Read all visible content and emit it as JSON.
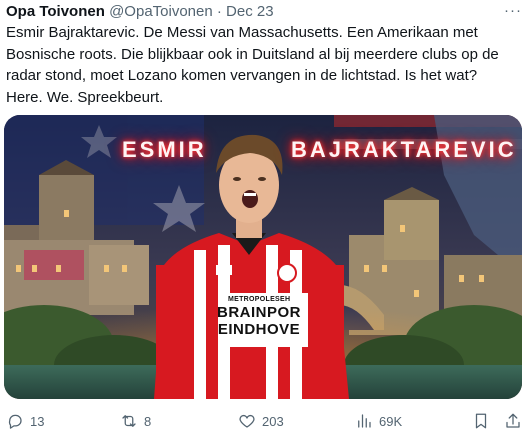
{
  "tweet": {
    "author_name": "Opa Toivonen",
    "author_handle": "@OpaToivonen",
    "separator": "·",
    "date": "Dec 23",
    "more": "···",
    "text": "Esmir Bajraktarevic. De Messi van Massachusetts. Een Amerikaan met\nBosnische roots. Die blijkbaar ook in Duitsland al bij meerdere clubs op de\nradar stond, moet Lozano komen vervangen in de lichtstad. Is het wat?\nHere. We. Spreekbeurt."
  },
  "media": {
    "first_name": "ESMIR",
    "last_name": "BAJRAKTAREVIC",
    "shirt_sponsor_top": "METROPOLESEH",
    "shirt_line1": "BRAINPOR",
    "shirt_line2": "EINDHOVE"
  },
  "actions": {
    "replies": "13",
    "reposts": "8",
    "likes": "203",
    "views": "69K"
  },
  "colors": {
    "text": "#0f1419",
    "secondary": "#536471",
    "glow_red": "#ff2020",
    "kit_red": "#d71920"
  },
  "icons": [
    "reply-icon",
    "repost-icon",
    "like-icon",
    "views-icon",
    "bookmark-icon",
    "share-icon"
  ]
}
